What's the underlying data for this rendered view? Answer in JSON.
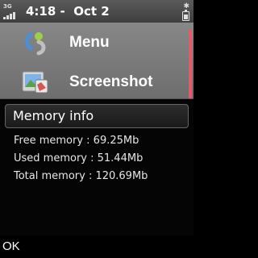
{
  "status_bar": {
    "network": "3G",
    "time_date": "4:18 -  Oct 2",
    "signal_level": 4,
    "battery_level": 0.6
  },
  "home": {
    "items": [
      {
        "label": "Menu",
        "icon": "menu-icon"
      },
      {
        "label": "Screenshot",
        "icon": "screenshot-app-icon"
      }
    ]
  },
  "dialog": {
    "title": "Memory info",
    "lines": [
      "Free memory : 69.25Mb",
      "Used memory : 51.44Mb",
      "Total memory : 120.69Mb"
    ]
  },
  "softkeys": {
    "left": "OK"
  },
  "colors": {
    "scroll_indicator": "#e55a6a"
  }
}
